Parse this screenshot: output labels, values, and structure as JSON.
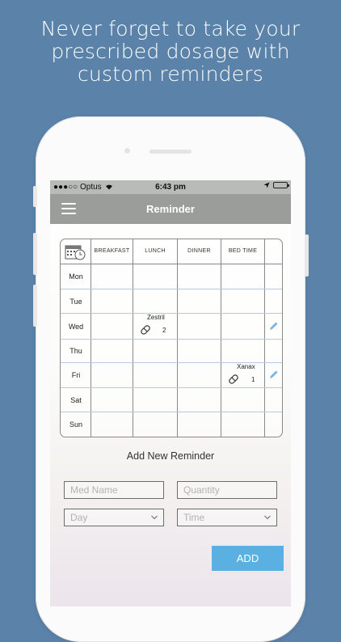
{
  "headline": [
    "Never forget to take your",
    "prescribed dosage with",
    "custom reminders"
  ],
  "status_bar": {
    "carrier": "●●●○○ Optus",
    "time": "6:43 pm"
  },
  "nav": {
    "title": "Reminder"
  },
  "grid": {
    "columns": [
      "BREAKFAST",
      "LUNCH",
      "DINNER",
      "BED TIME"
    ],
    "days": [
      "Mon",
      "Tue",
      "Wed",
      "Thu",
      "Fri",
      "Sat",
      "Sun"
    ],
    "entries": [
      {
        "day": "Wed",
        "column": "LUNCH",
        "name": "Zestril",
        "quantity": "2"
      },
      {
        "day": "Fri",
        "column": "BED TIME",
        "name": "Xanax",
        "quantity": "1"
      }
    ]
  },
  "form": {
    "title": "Add New Reminder",
    "med_name_placeholder": "Med Name",
    "quantity_placeholder": "Quantity",
    "day_value": "Day",
    "time_value": "Time",
    "add_label": "ADD"
  },
  "colors": {
    "background": "#5b82a8",
    "navbar": "#9a9d9a",
    "accent": "#5bb0e2"
  }
}
